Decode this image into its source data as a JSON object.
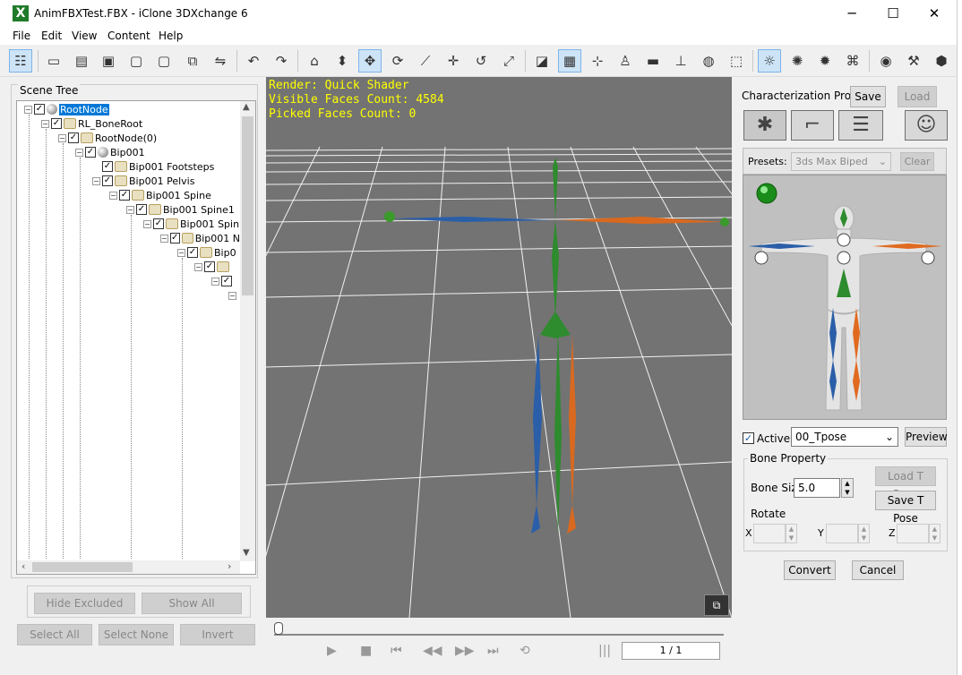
{
  "window": {
    "title": "AnimFBXTest.FBX - iClone 3DXchange 6",
    "app_icon": "x-logo-icon",
    "minimize": "─",
    "maximize": "☐",
    "close": "✕"
  },
  "menu": {
    "items": [
      "File",
      "Edit",
      "View",
      "Content",
      "Help"
    ]
  },
  "toolbar": {
    "icons": [
      "tree-view-icon",
      "open-folder-icon",
      "import-icon",
      "fbx-icon",
      "bvh-icon",
      "obj-icon",
      "export-icon",
      "convert-icon",
      "undo-icon",
      "redo-icon",
      "home-icon",
      "move-down-icon",
      "move-icon",
      "rotate-icon",
      "bone-icon",
      "pan-icon",
      "reset-icon",
      "scale-icon",
      "wireframe-icon",
      "grid-icon",
      "axis-icon",
      "figure-icon",
      "flat-icon",
      "ground-icon",
      "sphere-icon",
      "fit-icon",
      "light-icon",
      "sun-icon",
      "brightness-icon",
      "museum-icon",
      "globe-icon",
      "wrench-icon",
      "package-icon"
    ]
  },
  "scene": {
    "label": "Scene Tree",
    "nodes": [
      "RootNode",
      "RL_BoneRoot",
      "RootNode(0)",
      "Bip001",
      "Bip001 Footsteps",
      "Bip001 Pelvis",
      "Bip001 Spine",
      "Bip001 Spine1",
      "Bip001 Spin",
      "Bip001 N",
      "Bip0"
    ],
    "hide_excluded": "Hide Excluded",
    "show_all": "Show All",
    "select_all": "Select All",
    "select_none": "Select None",
    "invert": "Invert"
  },
  "viewport": {
    "render": "Render: Quick Shader",
    "visible_faces": "Visible Faces Count: 4584",
    "picked_faces": "Picked Faces Count: 0"
  },
  "timeline": {
    "frame": "1 / 1"
  },
  "characterization": {
    "label": "Characterization Profile",
    "save": "Save",
    "load": "Load",
    "presets_label": "Presets:",
    "preset_value": "3ds Max Biped",
    "clear": "Clear",
    "active_label": "Active",
    "pose_value": "00_Tpose",
    "preview": "Preview",
    "bone_property": "Bone Property",
    "load_t_pose": "Load T Pose",
    "bone_size_label": "Bone Size",
    "bone_size_value": "5.0",
    "save_t_pose": "Save T Pose",
    "rotate_label": "Rotate",
    "x_label": "X",
    "y_label": "Y",
    "z_label": "Z",
    "convert": "Convert",
    "cancel": "Cancel"
  }
}
